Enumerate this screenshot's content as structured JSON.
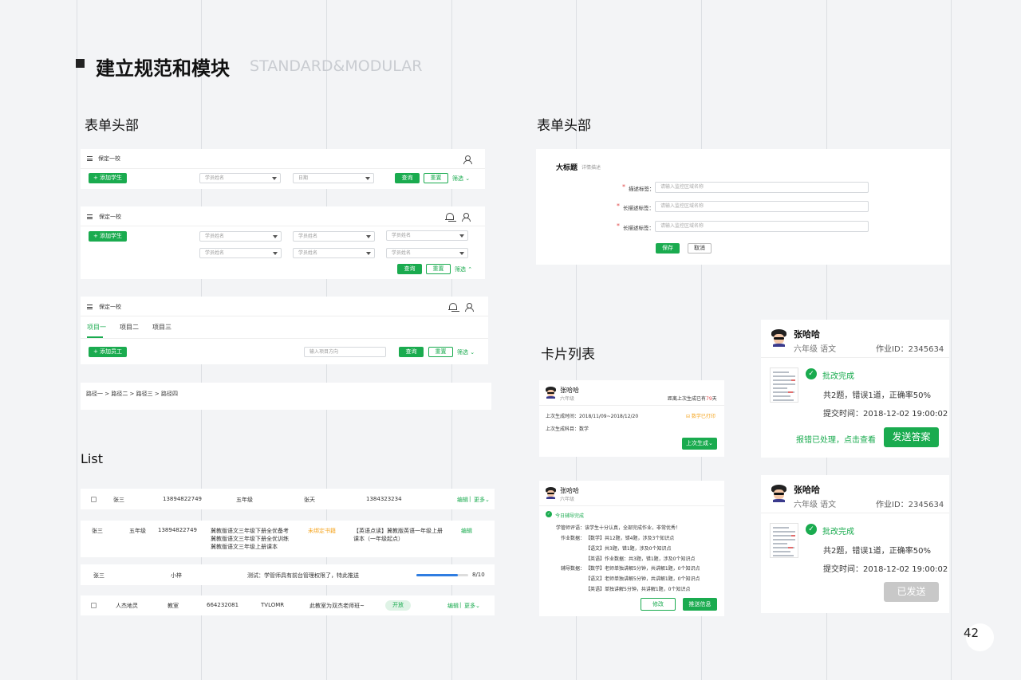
{
  "header": {
    "title": "建立规范和模块",
    "subtitle": "STANDARD&MODULAR"
  },
  "sections": {
    "form_header_left": "表单头部",
    "form_header_right": "表单头部",
    "list": "List",
    "card_list": "卡片列表"
  },
  "form1": {
    "school": "保定一校",
    "add_btn": "+ 添加学生",
    "select1": "学员姓名",
    "select2": "日期",
    "query": "查询",
    "reset": "重置",
    "filter": "筛选 ⌄"
  },
  "form2": {
    "school": "保定一校",
    "add_btn": "+ 添加学生",
    "selects": [
      "学员姓名",
      "学员姓名",
      "学员姓名",
      "学员姓名",
      "学员姓名",
      "学员姓名"
    ],
    "query": "查询",
    "reset": "重置",
    "filter": "筛选 ⌃"
  },
  "form3": {
    "school": "保定一校",
    "tabs": [
      "项目一",
      "项目二",
      "项目三"
    ],
    "add_btn": "+ 添加员工",
    "input_placeholder": "输入项目方向",
    "query": "查询",
    "reset": "重置",
    "filter": "筛选 ⌄"
  },
  "breadcrumb": "路径一 > 路径二 > 路径三 > 路径四",
  "form_right": {
    "title": "大标题",
    "desc": "详情描述",
    "fields": [
      {
        "label": "描述标签：",
        "placeholder": "请输入监控区域名称"
      },
      {
        "label": "长描述标签：",
        "placeholder": "请输入监控区域名称"
      },
      {
        "label": "长描述标签：",
        "placeholder": "请输入监控区域名称"
      }
    ],
    "required": "*",
    "save": "保存",
    "cancel": "取消"
  },
  "list": {
    "row1": {
      "name": "张三",
      "phone": "13894822749",
      "grade": "五年级",
      "teacher": "张天",
      "phone2": "1384323234",
      "edit": "编辑",
      "sep": "|",
      "more": "更多⌄"
    },
    "row2": {
      "name": "张三",
      "grade": "五年级",
      "phone": "13894822749",
      "books": [
        "冀教版语文三年级下册全优备考",
        "冀教版语文三年级下册全优训练",
        "冀教版语文三年级上册课本"
      ],
      "status": "未绑定书籍",
      "course1": "【英语点读】冀教版英语一年级上册",
      "course2": "课本（一年级起点）",
      "edit": "编辑"
    },
    "row3": {
      "name": "张三",
      "teacher": "小梓",
      "msg": "测试：学管师具有前台管理权限了，特此推送",
      "progress_value": 0.8,
      "progress_text": "8/10"
    },
    "row4": {
      "name": "人杰地灵",
      "type": "教室",
      "phone": "664232081",
      "code": "TVLOMR",
      "desc": "此教室为双杰老师班~",
      "tag": "开放",
      "edit": "编辑",
      "sep": "|",
      "more": "更多⌄"
    }
  },
  "card1": {
    "name": "张哈哈",
    "grade": "六年级",
    "days_prefix": "距离上次生成已有",
    "days": "79",
    "days_suffix": "天",
    "time_label": "上次生成时间：2018/11/09~2018/12/20",
    "print_label": "⊟ 数学已打印",
    "subject_label": "上次生成科目：数学",
    "button": "上次生成⌄"
  },
  "card2": {
    "name": "张哈哈",
    "grade": "六年级",
    "status": "今日辅导完成",
    "comment": "学管师评语：该学生十分认真，全部完成作业，非常优秀！",
    "homework_label": "作业数据：",
    "homework": [
      "【数学】共12题，错4题，涉及3个知识点",
      "【语文】共3题，错1题，涉及0个知识点",
      "【英语】作业数据：共3题，错1题，涉及0个知识点"
    ],
    "tutor_label": "辅导数据：",
    "tutor": [
      "【数学】老师单独讲解5分钟，共讲解1题，0个知识点",
      "【语文】老师单独讲解5分钟，共讲解1题，0个知识点",
      "【英语】单独讲解5分钟，共讲解1题，0个知识点"
    ],
    "modify": "修改",
    "push": "推送信息"
  },
  "card3": {
    "name": "张哈哈",
    "grade": "六年级 语文",
    "id": "作业ID：2345634",
    "status": "批改完成",
    "summary": "共2题，错误1道，正确率50%",
    "time": "提交时间：2018-12-02 19:00:02",
    "link": "报错已处理，点击查看",
    "button": "发送答案"
  },
  "card4": {
    "name": "张哈哈",
    "grade": "六年级 语文",
    "id": "作业ID：2345634",
    "status": "批改完成",
    "summary": "共2题，错误1道，正确率50%",
    "time": "提交时间：2018-12-02 19:00:02",
    "button": "已发送"
  },
  "page_number": "42",
  "colors": {
    "accent": "#1aab4f",
    "warning": "#f5a623",
    "danger": "#e14b4b",
    "disabled": "#c8c8c8"
  }
}
